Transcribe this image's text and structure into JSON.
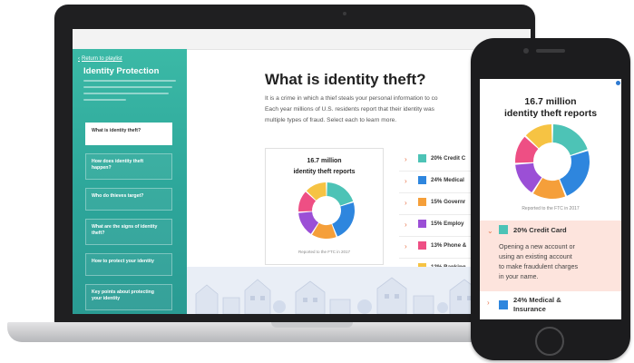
{
  "laptop": {
    "sidebar": {
      "back_link": "Return to playlist",
      "title": "Identity Protection",
      "nav_items": [
        {
          "label": "What is identity theft?",
          "active": true
        },
        {
          "label_lines": [
            "How does identity theft",
            "happen?"
          ]
        },
        {
          "label": "Who do thieves target?"
        },
        {
          "label_lines": [
            "What are the signs of identity",
            "theft?"
          ]
        },
        {
          "label": "How to protect your identity"
        },
        {
          "label_lines": [
            "Key points about protecting",
            "your identity"
          ]
        }
      ]
    },
    "main": {
      "title": "What is identity theft?",
      "description_lines": [
        "It is a crime in which a thief steals your personal information to co",
        "Each year millions of U.S. residents report that their identity was",
        "multiple types of fraud. Select each to learn more."
      ]
    },
    "chart_card": {
      "stat": "16.7 million",
      "label": "identity theft reports",
      "source": "Reported to the FTC in 2017"
    },
    "legend": [
      {
        "text": "20% Credit C"
      },
      {
        "text": "24% Medical"
      },
      {
        "text": "15% Governr"
      },
      {
        "text": "15% Employ"
      },
      {
        "text": "13% Phone &"
      },
      {
        "text": "13% Banking"
      }
    ]
  },
  "phone": {
    "stat": "16.7 million",
    "label": "identity theft reports",
    "source": "Reported to the FTC in 2017",
    "expanded": {
      "title": "20% Credit Card",
      "body_lines": [
        "Opening a new account or",
        "using an existing account",
        "to make fraudulent charges",
        "in your name."
      ]
    },
    "next_item": {
      "title_lines": [
        "24% Medical &",
        "Insurance"
      ]
    }
  },
  "chart_data": {
    "type": "pie",
    "categories": [
      "Credit Card",
      "Medical & Insurance",
      "Government",
      "Employment",
      "Phone &",
      "Banking"
    ],
    "values": [
      20,
      24,
      15,
      15,
      13,
      13
    ],
    "colors": [
      "#4dc3b6",
      "#2e86de",
      "#f59f3a",
      "#9b4fd6",
      "#ee4f84",
      "#f6c343"
    ],
    "title": "16.7 million identity theft reports",
    "annotation": "Reported to the FTC in 2017"
  },
  "colors": {
    "accent": "#3bb9a6",
    "chevron": "#e87a52",
    "expanded_bg": "#fde4dd"
  }
}
